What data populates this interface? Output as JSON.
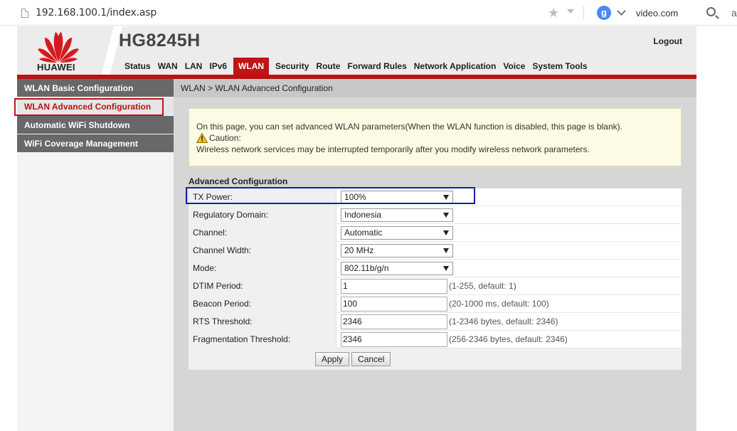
{
  "browser": {
    "url": "192.168.100.1/index.asp",
    "search_engine": "video.com",
    "extra": "a"
  },
  "header": {
    "brand": "HUAWEI",
    "model": "HG8245H",
    "logout": "Logout",
    "tabs": [
      "Status",
      "WAN",
      "LAN",
      "IPv6",
      "WLAN",
      "Security",
      "Route",
      "Forward Rules",
      "Network Application",
      "Voice",
      "System Tools"
    ],
    "active_tab": "WLAN"
  },
  "sidebar": {
    "items": [
      {
        "label": "WLAN Basic Configuration",
        "active": false
      },
      {
        "label": "WLAN Advanced Configuration",
        "active": true
      },
      {
        "label": "Automatic WiFi Shutdown",
        "active": false
      },
      {
        "label": "WiFi Coverage Management",
        "active": false
      }
    ]
  },
  "main": {
    "breadcrumb": "WLAN > WLAN Advanced Configuration",
    "info": {
      "line1": "On this page, you can set advanced WLAN parameters(When the WLAN function is disabled, this page is blank).",
      "caution_label": "Caution:",
      "line3": "Wireless network services may be interrupted temporarily after you modify wireless network parameters."
    },
    "section_title": "Advanced Configuration",
    "fields": [
      {
        "label": "TX Power:",
        "type": "select",
        "value": "100%"
      },
      {
        "label": "Regulatory Domain:",
        "type": "select",
        "value": "Indonesia"
      },
      {
        "label": "Channel:",
        "type": "select",
        "value": "Automatic"
      },
      {
        "label": "Channel Width:",
        "type": "select",
        "value": "20 MHz"
      },
      {
        "label": "Mode:",
        "type": "select",
        "value": "802.11b/g/n"
      },
      {
        "label": "DTIM Period:",
        "type": "text",
        "value": "1",
        "hint": "(1-255, default: 1)"
      },
      {
        "label": "Beacon Period:",
        "type": "text",
        "value": "100",
        "hint": "(20-1000 ms, default: 100)"
      },
      {
        "label": "RTS Threshold:",
        "type": "text",
        "value": "2346",
        "hint": "(1-2346 bytes, default: 2346)"
      },
      {
        "label": "Fragmentation Threshold:",
        "type": "text",
        "value": "2346",
        "hint": "(256-2346 bytes, default: 2346)"
      }
    ],
    "buttons": {
      "apply": "Apply",
      "cancel": "Cancel"
    }
  },
  "colors": {
    "brand_red": "#c11414",
    "nav_gray": "#686868",
    "highlight_blue": "#1520a0"
  }
}
